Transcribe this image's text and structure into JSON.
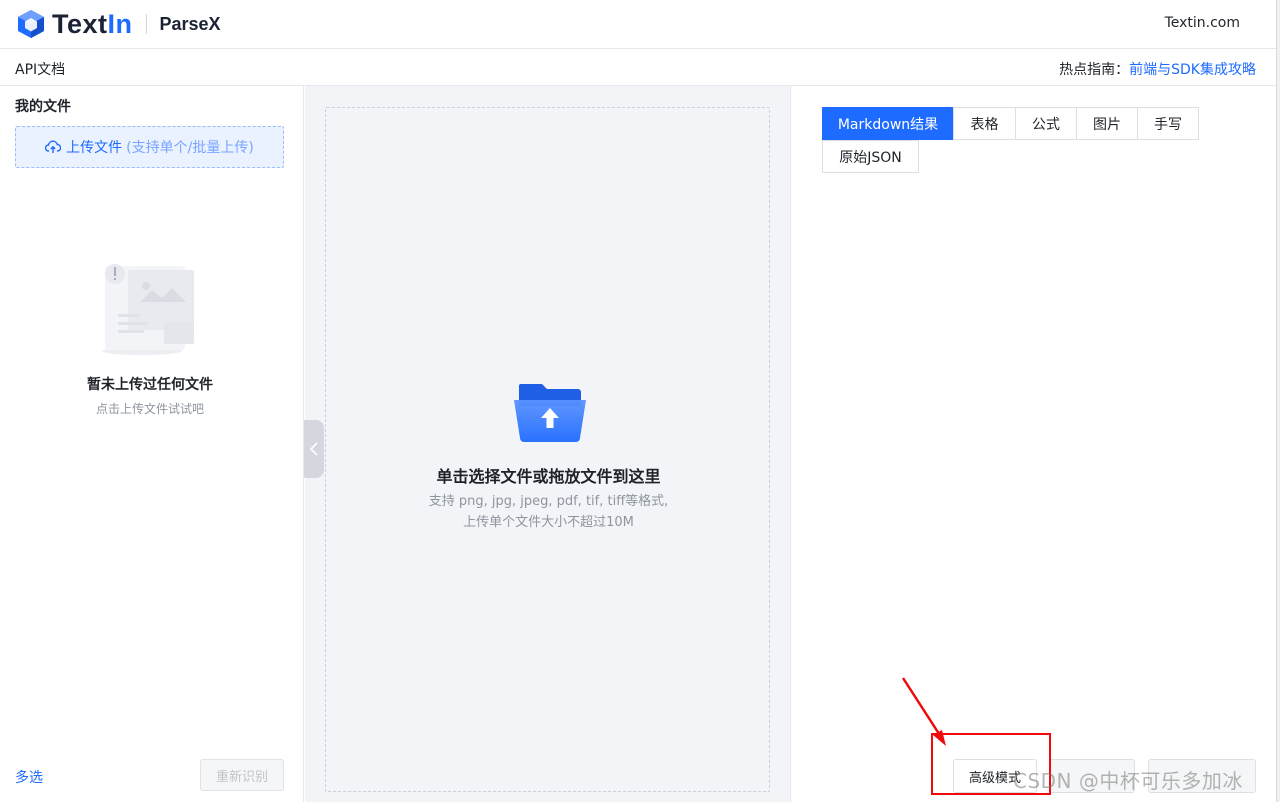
{
  "header": {
    "brand_text": "Text",
    "brand_accent": "In",
    "product": "ParseX",
    "site_link": "Textin.com"
  },
  "subbar": {
    "api_docs": "API文档",
    "hot_label": "热点指南：",
    "hot_link": "前端与SDK集成攻略"
  },
  "left": {
    "title": "我的文件",
    "upload_label": "上传文件",
    "upload_hint": "(支持单个/批量上传)",
    "empty_title": "暂未上传过任何文件",
    "empty_sub": "点击上传文件试试吧",
    "multi_select": "多选",
    "re_recognize": "重新识别"
  },
  "middle": {
    "drop_title": "单击选择文件或拖放文件到这里",
    "drop_formats": "支持 png, jpg, jpeg, pdf, tif, tiff等格式,",
    "drop_limit": "上传单个文件大小不超过10M"
  },
  "right": {
    "tabs": [
      {
        "label": "Markdown结果",
        "active": true
      },
      {
        "label": "表格",
        "active": false
      },
      {
        "label": "公式",
        "active": false
      },
      {
        "label": "图片",
        "active": false
      },
      {
        "label": "手写",
        "active": false
      },
      {
        "label": "原始JSON",
        "active": false
      }
    ],
    "advanced_mode": "高级模式"
  },
  "watermark": "CSDN @中杯可乐多加冰",
  "colors": {
    "accent": "#1e6bff",
    "annotation": "#f00a0a"
  }
}
